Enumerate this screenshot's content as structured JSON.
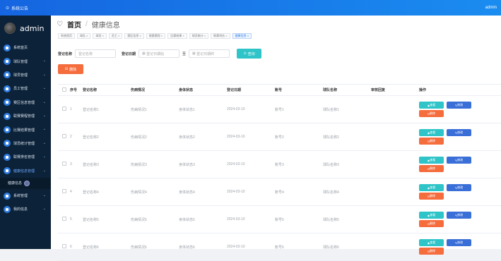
{
  "topbar": {
    "notice": "系统公告",
    "user": "admin"
  },
  "sidebar": {
    "username": "admin",
    "items": [
      {
        "label": "系统首页",
        "chevron": false
      },
      {
        "label": "球队管理",
        "chevron": true
      },
      {
        "label": "球员管理",
        "chevron": true
      },
      {
        "label": "员工管理",
        "chevron": true
      },
      {
        "label": "赛区信息管理",
        "chevron": true
      },
      {
        "label": "联赛赛程管理",
        "chevron": true
      },
      {
        "label": "比赛结果管理",
        "chevron": true
      },
      {
        "label": "球员统计管理",
        "chevron": true
      },
      {
        "label": "联赛排名管理",
        "chevron": true
      },
      {
        "label": "健康信息管理",
        "chevron": true
      },
      {
        "label": "系统管理",
        "chevron": true
      },
      {
        "label": "我的信息",
        "chevron": true
      }
    ],
    "subitem": "健康信息"
  },
  "header": {
    "home": "首页",
    "separator": "/",
    "current": "健康信息"
  },
  "tags": [
    "系统首页",
    "球队 ×",
    "球员 ×",
    "员工 ×",
    "赛区信息 ×",
    "联赛赛程 ×",
    "比赛结果 ×",
    "球员统计 ×",
    "联赛排名 ×",
    "健康信息 ×"
  ],
  "filters": {
    "name_label": "登记名称",
    "name_placeholder": "登记名称",
    "date_label": "登记日期",
    "date_start": "登记日期始",
    "to": "至",
    "date_end": "登记日期终",
    "search": "查询",
    "delete": "删除"
  },
  "table": {
    "headers": [
      "",
      "序号",
      "登记名称",
      "伤病情况",
      "身体状态",
      "登记日期",
      "账号",
      "球队名称",
      "审核回复",
      "操作"
    ],
    "actions": {
      "view": "查看",
      "edit": "修改",
      "delete": "删除"
    },
    "rows": [
      [
        "1",
        "登记名称1",
        "伤病情况1",
        "身体状态1",
        "2024-03-10",
        "账号1",
        "球队名称1",
        ""
      ],
      [
        "2",
        "登记名称2",
        "伤病情况2",
        "身体状态2",
        "2024-03-10",
        "账号2",
        "球队名称2",
        ""
      ],
      [
        "3",
        "登记名称3",
        "伤病情况3",
        "身体状态3",
        "2024-03-10",
        "账号3",
        "球队名称3",
        ""
      ],
      [
        "4",
        "登记名称4",
        "伤病情况4",
        "身体状态4",
        "2024-03-10",
        "账号4",
        "球队名称4",
        ""
      ],
      [
        "5",
        "登记名称5",
        "伤病情况5",
        "身体状态5",
        "2024-03-10",
        "账号5",
        "球队名称5",
        ""
      ],
      [
        "6",
        "登记名称6",
        "伤病情况6",
        "身体状态6",
        "2024-03-10",
        "账号6",
        "球队名称6",
        ""
      ]
    ]
  }
}
